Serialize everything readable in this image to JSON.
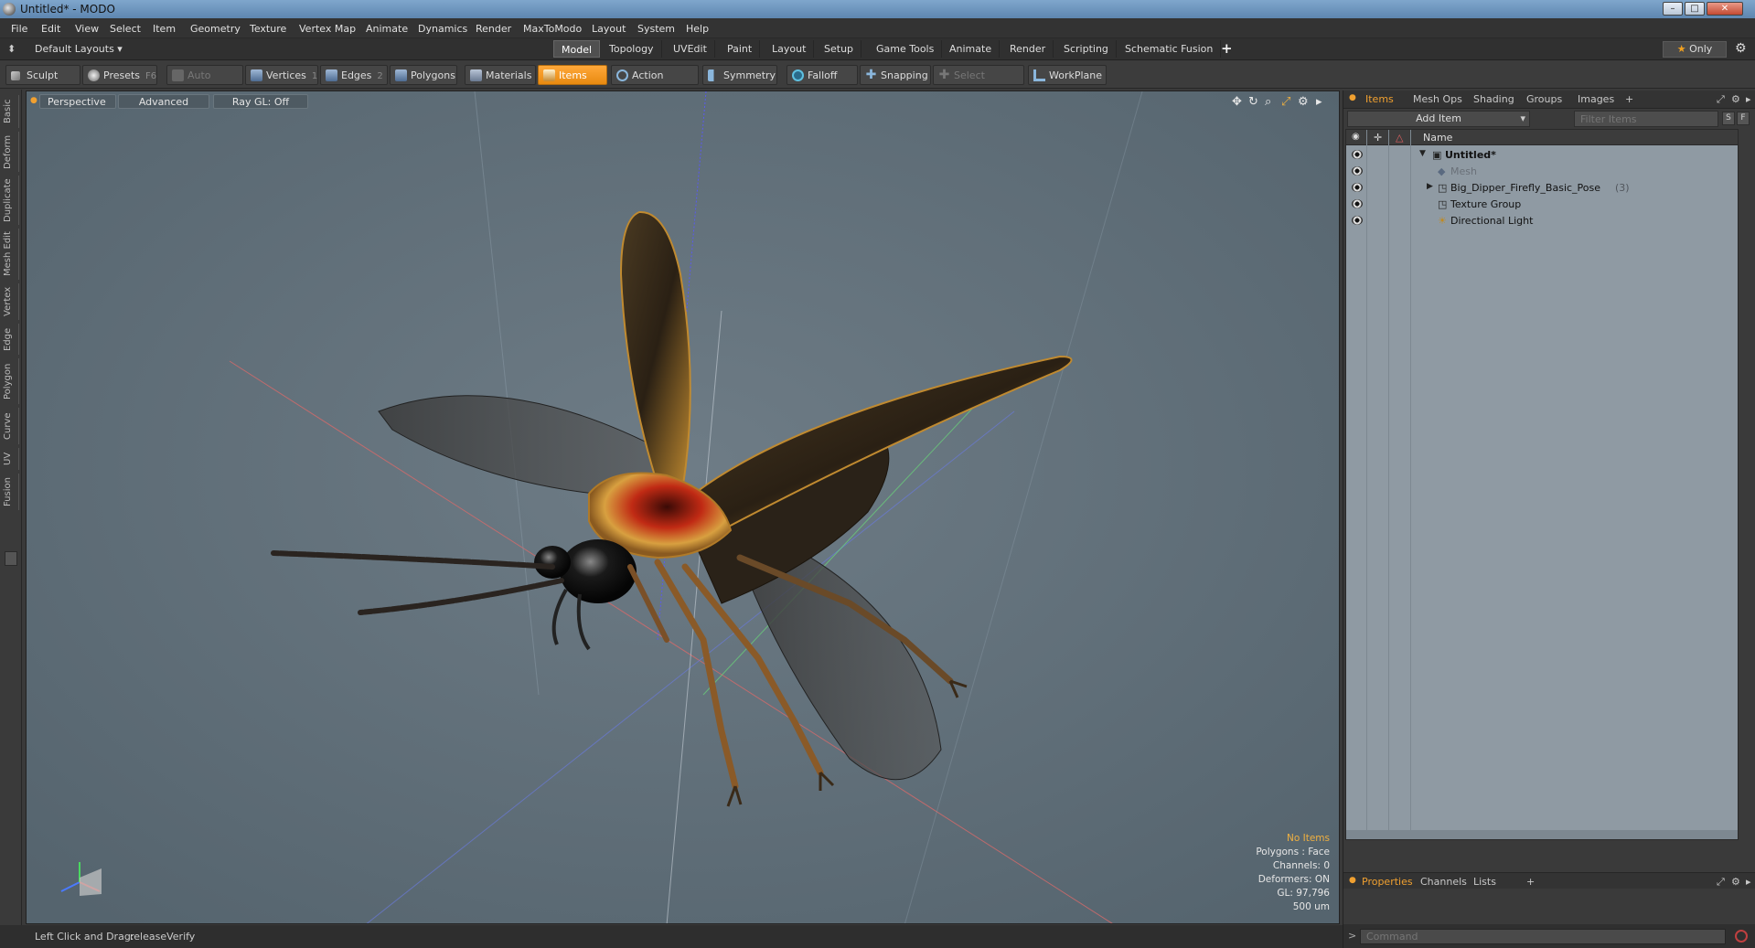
{
  "window": {
    "title": "Untitled* - MODO",
    "controls": [
      "–",
      "□",
      "✕"
    ]
  },
  "menu": [
    "File",
    "Edit",
    "View",
    "Select",
    "Item",
    "Geometry",
    "Texture",
    "Vertex Map",
    "Animate",
    "Dynamics",
    "Render",
    "MaxToModo",
    "Layout",
    "System",
    "Help"
  ],
  "layout_bar": {
    "default_layouts": "Default Layouts ▾",
    "tabs": [
      "Model",
      "Topology",
      "UVEdit",
      "Paint",
      "Layout",
      "Setup",
      "Game Tools",
      "Animate",
      "Render",
      "Scripting",
      "Schematic Fusion"
    ],
    "active_tab": "Model",
    "add": "+",
    "only_label": "Only",
    "only_star": "★",
    "gear": "⚙"
  },
  "toolbar": {
    "sculpt": "Sculpt",
    "presets": "Presets",
    "presets_key": "F6",
    "auto_select": "Auto Select",
    "vertices": "Vertices",
    "vertices_key": "1",
    "edges": "Edges",
    "edges_key": "2",
    "polygons": "Polygons",
    "materials": "Materials",
    "items": "Items",
    "action_center": "Action Center",
    "symmetry": "Symmetry",
    "falloff": "Falloff",
    "snapping": "Snapping",
    "select_through": "Select Through",
    "workplane": "WorkPlane"
  },
  "left_tabs": [
    "Basic",
    "Deform",
    "Duplicate",
    "Mesh Edit",
    "Vertex",
    "Edge",
    "Polygon",
    "Curve",
    "UV",
    "Fusion"
  ],
  "viewport": {
    "view": "Perspective",
    "shading": "Advanced",
    "raygl": "Ray GL: Off",
    "controls": [
      "✥",
      "↻",
      "⌕",
      "⤢",
      "⚙",
      "▸"
    ],
    "stats": {
      "selection": "No Items",
      "polygons": "Polygons : Face",
      "channels": "Channels: 0",
      "deformers": "Deformers: ON",
      "gl": "GL: 97,796",
      "scale": "500 um"
    }
  },
  "status": {
    "hint_label": "Left Click and Drag:",
    "hint_value": "releaseVerify"
  },
  "right_panel": {
    "tabs": [
      "Items",
      "Mesh Ops",
      "Shading",
      "Groups",
      "Images",
      "+"
    ],
    "active_tab": "Items",
    "add_item": "Add Item",
    "filter_placeholder": "Filter Items",
    "small_buttons": [
      "S",
      "F"
    ],
    "column_name": "Name",
    "tree": [
      {
        "label": "Untitled*",
        "indent": 0,
        "expand": "▼",
        "style": "bold",
        "count": ""
      },
      {
        "label": "Mesh",
        "indent": 1,
        "expand": "",
        "style": "muted",
        "count": ""
      },
      {
        "label": "Big_Dipper_Firefly_Basic_Pose",
        "indent": 1,
        "expand": "▶",
        "style": "",
        "count": "(3)"
      },
      {
        "label": "Texture Group",
        "indent": 1,
        "expand": "",
        "style": "",
        "count": ""
      },
      {
        "label": "Directional Light",
        "indent": 1,
        "expand": "",
        "style": "",
        "count": ""
      }
    ],
    "properties_tabs": [
      "Properties",
      "Channels",
      "Lists",
      "+"
    ],
    "command_placeholder": "Command"
  },
  "colors": {
    "accent": "#f0a030",
    "viewport_bg": "#5f6f7a",
    "tree_bg": "#8f9aa3"
  }
}
